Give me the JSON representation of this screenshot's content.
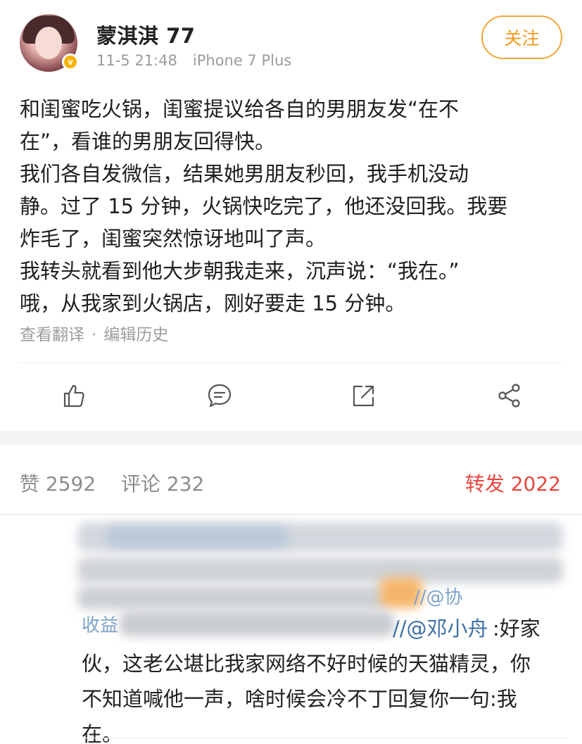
{
  "post": {
    "username": "蒙淇淇 77",
    "time": "11-5 21:48",
    "device": "iPhone 7 Plus",
    "follow_label": "关注",
    "verified_badge": "v",
    "lines": [
      "和闺蜜吃火锅，闺蜜提议给各自的男朋友发“在不",
      "在”，看谁的男朋友回得快。",
      "我们各自发微信，结果她男朋友秒回，我手机没动",
      "静。过了 15 分钟，火锅快吃完了，他还没回我。我要",
      "炸毛了，闺蜜突然惊讶地叫了声。",
      "我转头就看到他大步朝我走来，沉声说：“我在。”",
      "哦，从我家到火锅店，刚好要走 15 分钟。"
    ],
    "translate_link": "查看翻译",
    "separator": "·",
    "edit_history_link": "编辑历史"
  },
  "actions": {
    "like": "like-icon",
    "comment": "comment-icon",
    "repost": "repost-icon",
    "share": "share-icon"
  },
  "stats": {
    "likes": "赞 2592",
    "comments": "评论 232",
    "reposts": "转发 2022",
    "repost_color": "#e8473e"
  },
  "comment": {
    "mention_partial": "//@协",
    "prefix_partial": "收益",
    "mention": "//@邓小舟",
    "lines": [
      ":好家",
      "伙，这老公堪比我家网络不好时候的天猫精灵，你",
      "不知道喊他一声，啥时候会冷不丁回复你一句:我",
      "在。"
    ]
  }
}
